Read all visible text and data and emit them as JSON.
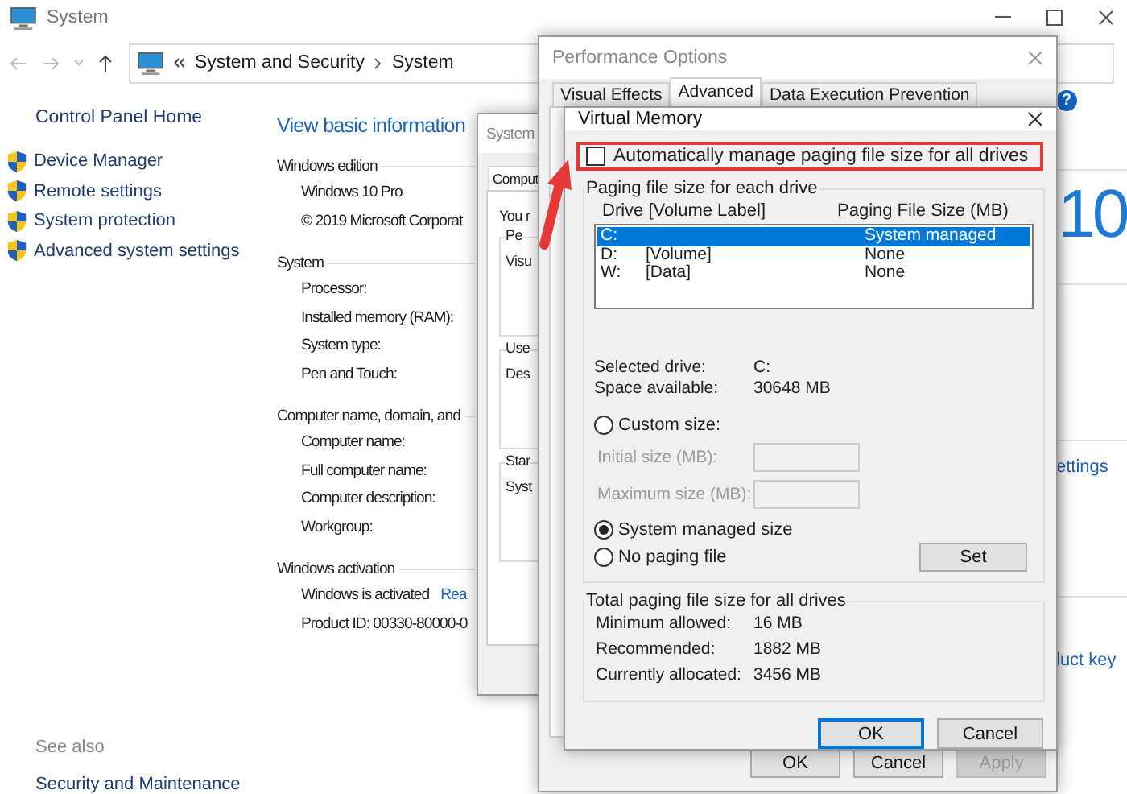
{
  "main_window": {
    "title": "System",
    "breadcrumb": [
      "System and Security",
      "System"
    ],
    "sidebar": {
      "home": "Control Panel Home",
      "links": [
        "Device Manager",
        "Remote settings",
        "System protection",
        "Advanced system settings"
      ],
      "see_also": "See also",
      "see_also_links": [
        "Security and Maintenance"
      ]
    },
    "content": {
      "heading": "View basic information",
      "sections": [
        {
          "title": "Windows edition",
          "rows": [
            {
              "text": "Windows 10 Pro"
            },
            {
              "text": "© 2019 Microsoft Corporat"
            }
          ]
        },
        {
          "title": "System",
          "rows": [
            {
              "text": "Processor:"
            },
            {
              "text": "Installed memory (RAM):"
            },
            {
              "text": "System type:"
            },
            {
              "text": "Pen and Touch:"
            }
          ]
        },
        {
          "title": "Computer name, domain, and",
          "rows": [
            {
              "text": "Computer name:"
            },
            {
              "text": "Full computer name:"
            },
            {
              "text": "Computer description:"
            },
            {
              "text": "Workgroup:"
            }
          ]
        },
        {
          "title": "Windows activation",
          "rows": [
            {
              "text": "Windows is activated",
              "link": "Rea"
            },
            {
              "text": "Product ID: 00330-80000-0"
            }
          ]
        }
      ]
    },
    "help": "?",
    "logo_text": "10",
    "right_links": [
      "ettings",
      "luct key"
    ]
  },
  "system_properties": {
    "title": "System",
    "tab": "Comput",
    "intro": "You r",
    "groups": [
      {
        "title": "Pe",
        "text": "Visu"
      },
      {
        "title": "Use",
        "text": "Des"
      },
      {
        "title": "Star",
        "text": "Syst"
      }
    ]
  },
  "performance_options": {
    "title": "Performance Options",
    "tabs": [
      {
        "label": "Visual Effects",
        "selected": false
      },
      {
        "label": "Advanced",
        "selected": true
      },
      {
        "label": "Data Execution Prevention",
        "selected": false
      }
    ],
    "buttons": [
      {
        "label": "OK",
        "disabled": false
      },
      {
        "label": "Cancel",
        "disabled": false
      },
      {
        "label": "Apply",
        "disabled": true
      }
    ]
  },
  "virtual_memory": {
    "title": "Virtual Memory",
    "auto_manage": {
      "label": "Automatically manage paging file size for all drives",
      "checked": false
    },
    "paging_group": {
      "title": "Paging file size for each drive",
      "columns": [
        "Drive  [Volume Label]",
        "Paging File Size (MB)"
      ],
      "drives": [
        {
          "drive": "C:",
          "size": "System managed",
          "selected": true
        },
        {
          "drive": "D:",
          "volume": "[Volume]",
          "size": "None",
          "selected": false
        },
        {
          "drive": "W:",
          "volume": "[Data]",
          "size": "None",
          "selected": false
        }
      ],
      "info": [
        {
          "label": "Selected drive:",
          "value": "C:"
        },
        {
          "label": "Space available:",
          "value": "30648 MB"
        }
      ],
      "custom": {
        "label": "Custom size:",
        "selected": false
      },
      "fields": [
        {
          "label": "Initial size (MB):",
          "disabled": true
        },
        {
          "label": "Maximum size (MB):",
          "disabled": true
        }
      ],
      "system_managed": {
        "label": "System managed size",
        "selected": true
      },
      "no_paging": {
        "label": "No paging file",
        "selected": false
      },
      "set_button": "Set"
    },
    "totals": {
      "title": "Total paging file size for all drives",
      "rows": [
        {
          "label": "Minimum allowed:",
          "value": "16 MB"
        },
        {
          "label": "Recommended:",
          "value": "1882 MB"
        },
        {
          "label": "Currently allocated:",
          "value": "3456 MB"
        }
      ]
    },
    "buttons": [
      {
        "label": "OK",
        "default": true
      },
      {
        "label": "Cancel",
        "default": false
      }
    ]
  }
}
